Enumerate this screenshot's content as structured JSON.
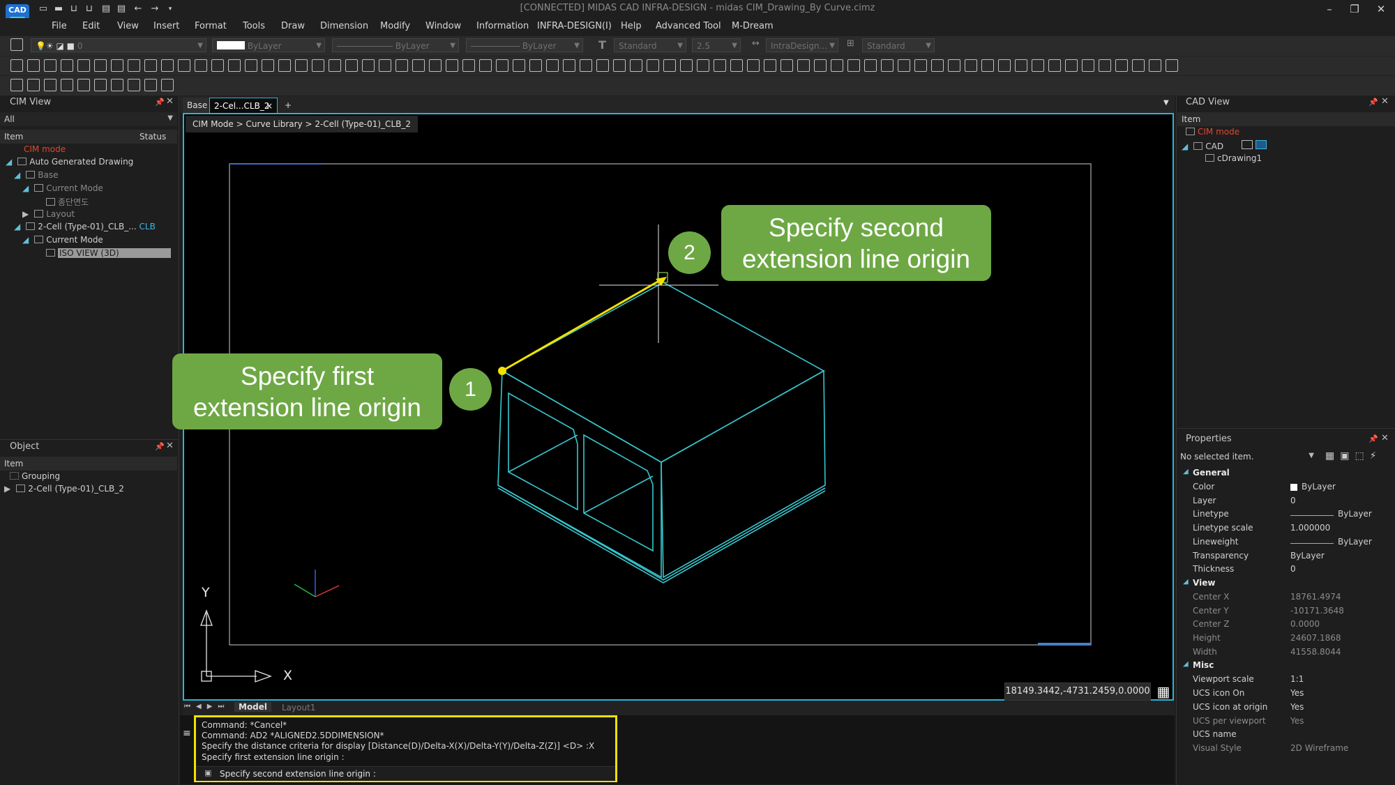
{
  "app": {
    "logo_text": "CAD",
    "title": "[CONNECTED] MIDAS CAD INFRA-DESIGN - midas CIM_Drawing_By Curve.cimz"
  },
  "menu": [
    "File",
    "Edit",
    "View",
    "Insert",
    "Format",
    "Tools",
    "Draw",
    "Dimension",
    "Modify",
    "Window",
    "Information",
    "INFRA-DESIGN(I)",
    "Help",
    "Advanced Tool",
    "M-Dream"
  ],
  "props_toolbar": {
    "layer_value": "0",
    "color_value": "ByLayer",
    "linetype_value": "ByLayer",
    "lineweight_value": "ByLayer",
    "text_style": "Standard",
    "text_height": "2.5",
    "dim_style": "IntraDesign...",
    "table_style": "Standard"
  },
  "cim_view": {
    "title": "CIM View",
    "filter": "All",
    "col_item": "Item",
    "col_status": "Status",
    "items": {
      "cim_mode": "CIM mode",
      "auto_generated": "Auto Generated Drawing",
      "base": "Base",
      "current_mode_1": "Current Mode",
      "korean_item": "종단면도",
      "layout": "Layout",
      "cell": "2-Cell (Type-01)_CLB_...",
      "cell_status": "CLB",
      "current_mode_2": "Current Mode",
      "iso_view": "ISO VIEW (3D)"
    }
  },
  "object_panel": {
    "title": "Object",
    "col_item": "Item",
    "grouping": "Grouping",
    "cell": "2-Cell (Type-01)_CLB_2"
  },
  "doc_tabs": {
    "base": "Base",
    "active": "2-Cel...CLB_2",
    "close": "×",
    "add": "+"
  },
  "breadcrumb": "CIM Mode > Curve Library > 2-Cell (Type-01)_CLB_2",
  "callouts": {
    "first_line1": "Specify first",
    "first_line2": "extension line origin",
    "first_num": "1",
    "second_line1": "Specify second",
    "second_line2": "extension line origin",
    "second_num": "2"
  },
  "ucs": {
    "x": "X",
    "y": "Y"
  },
  "coords": "18149.3442,-4731.2459,0.0000",
  "layout_tabs": {
    "model": "Model",
    "layout1": "Layout1"
  },
  "command": {
    "lines": [
      "Command:  *Cancel*",
      "Command:  AD2 *ALIGNED2.5DDIMENSION*",
      "Specify the distance criteria for display [Distance(D)/Delta-X(X)/Delta-Y(Y)/Delta-Z(Z)] <D> :X",
      "Specify first extension line origin :"
    ],
    "prompt": "Specify second extension line origin :"
  },
  "cad_view": {
    "title": "CAD View",
    "col_item": "Item",
    "cim_mode": "CIM mode",
    "cad": "CAD",
    "drawing": "cDrawing1"
  },
  "properties": {
    "title": "Properties",
    "selection": "No selected item.",
    "sections": {
      "general": "General",
      "view": "View",
      "misc": "Misc"
    },
    "general": [
      {
        "label": "Color",
        "value": "ByLayer"
      },
      {
        "label": "Layer",
        "value": "0"
      },
      {
        "label": "Linetype",
        "value": "ByLayer"
      },
      {
        "label": "Linetype scale",
        "value": "1.000000"
      },
      {
        "label": "Lineweight",
        "value": "ByLayer"
      },
      {
        "label": "Transparency",
        "value": "ByLayer"
      },
      {
        "label": "Thickness",
        "value": "0"
      }
    ],
    "view": [
      {
        "label": "Center X",
        "value": "18761.4974"
      },
      {
        "label": "Center Y",
        "value": "-10171.3648"
      },
      {
        "label": "Center Z",
        "value": "0.0000"
      },
      {
        "label": "Height",
        "value": "24607.1868"
      },
      {
        "label": "Width",
        "value": "41558.8044"
      }
    ],
    "misc": [
      {
        "label": "Viewport scale",
        "value": "1:1"
      },
      {
        "label": "UCS icon On",
        "value": "Yes"
      },
      {
        "label": "UCS icon at origin",
        "value": "Yes"
      },
      {
        "label": "UCS per viewport",
        "value": "Yes"
      },
      {
        "label": "UCS name",
        "value": ""
      },
      {
        "label": "Visual Style",
        "value": "2D Wireframe"
      }
    ]
  },
  "colors": {
    "accent": "#29b6d8",
    "callout_green": "#6ea845",
    "highlight_yellow": "#f2e100",
    "cim_red": "#e0482a",
    "model_cyan": "#37c8cf"
  }
}
